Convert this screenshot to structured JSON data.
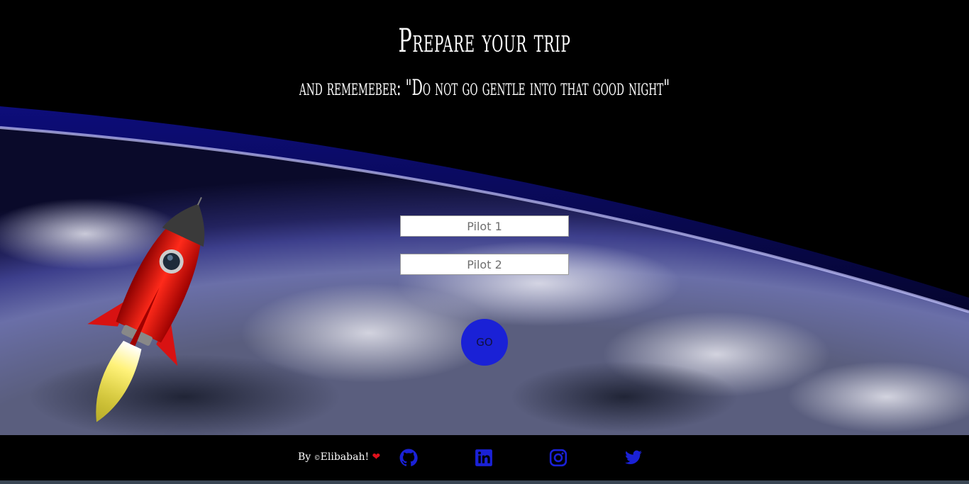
{
  "header": {
    "title": "Prepare your trip",
    "subtitle": "and rememeber: \"Do not go gentle into that good night\""
  },
  "form": {
    "pilot1_placeholder": "Pilot 1",
    "pilot2_placeholder": "Pilot 2",
    "go_label": "GO"
  },
  "footer": {
    "by_label": "By",
    "copyright_symbol": "©",
    "author": "Elibabah!",
    "social": [
      "github-icon",
      "linkedin-icon",
      "instagram-icon",
      "twitter-icon"
    ]
  },
  "colors": {
    "accent": "#1a21d6",
    "heart": "#e0101b",
    "background": "#000000"
  }
}
